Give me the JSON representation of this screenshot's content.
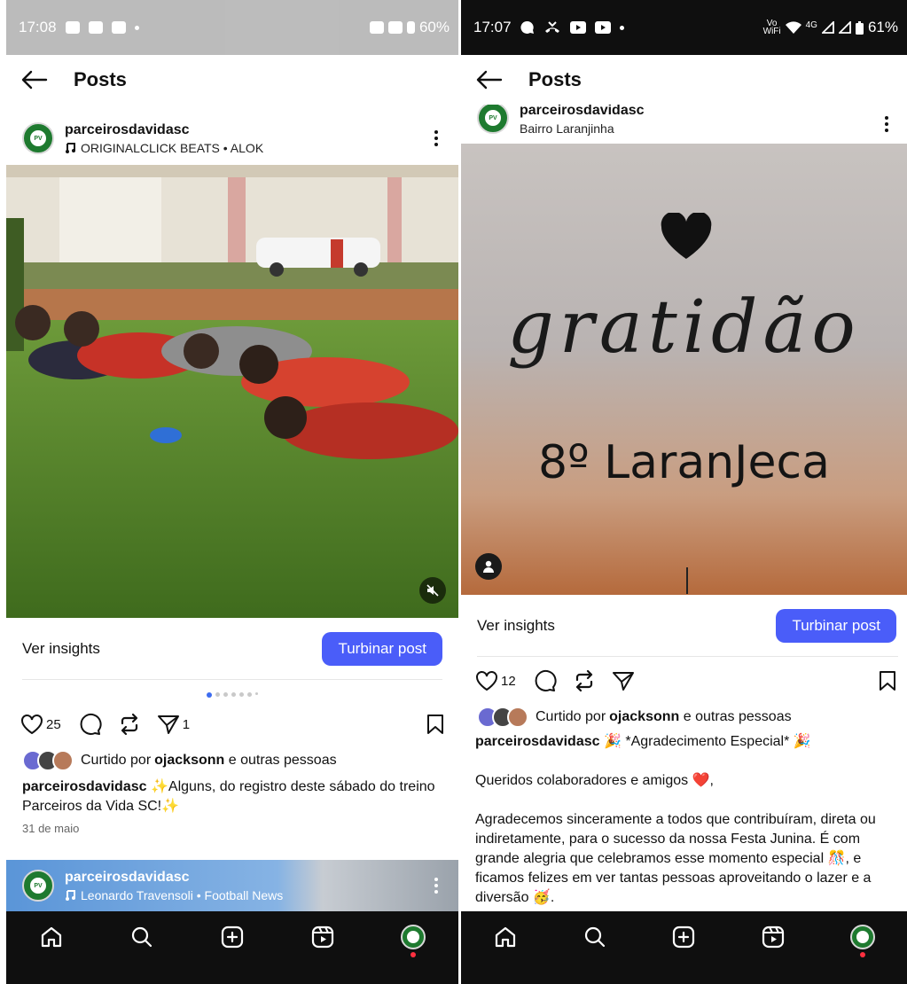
{
  "left": {
    "status": {
      "time": "17:08",
      "battery": "60%"
    },
    "header": {
      "title": "Posts"
    },
    "post": {
      "username": "parceirosdavidasc",
      "audio": "ORIGINALCLICK BEATS • ALOK",
      "insights_label": "Ver insights",
      "boost_label": "Turbinar post",
      "likes": "25",
      "shares": "1",
      "liked_by_prefix": "Curtido por ",
      "liked_by_user": "ojacksonn",
      "liked_by_suffix": " e outras pessoas",
      "caption_user": "parceirosdavidasc",
      "caption_text": " ✨Alguns, do registro deste sábado do treino Parceiros da Vida SC!✨",
      "date": "31 de maio"
    },
    "next_post": {
      "username": "parceirosdavidasc",
      "audio": "Leonardo Travensoli • Football News"
    }
  },
  "right": {
    "status": {
      "time": "17:07",
      "battery": "61%",
      "network": "4G",
      "vowifi_top": "Vo",
      "vowifi_bottom": "WiFi"
    },
    "header": {
      "title": "Posts"
    },
    "post": {
      "username": "parceirosdavidasc",
      "location": "Bairro Laranjinha",
      "media_script_text": "gratidão",
      "media_title": "8º LaranJeca",
      "insights_label": "Ver insights",
      "boost_label": "Turbinar post",
      "likes": "12",
      "liked_by_prefix": "Curtido por ",
      "liked_by_user": "ojacksonn",
      "liked_by_suffix": " e outras pessoas",
      "caption_user": "parceirosdavidasc",
      "caption_line1": " 🎉 *Agradecimento Especial* 🎉",
      "caption_p2": "Queridos colaboradores e amigos ❤️,",
      "caption_p3": "Agradecemos sinceramente a todos que contribuíram, direta ou indiretamente, para o sucesso da nossa Festa Junina. É com grande alegria que celebramos esse momento especial 🎊, e ficamos felizes em ver tantas pessoas aproveitando o lazer e a diversão 🥳."
    }
  },
  "colors": {
    "boost": "#4a5df9",
    "accent_green": "#1e7a2f",
    "notification": "#ff3040",
    "carousel_active": "#3d6cf0"
  }
}
